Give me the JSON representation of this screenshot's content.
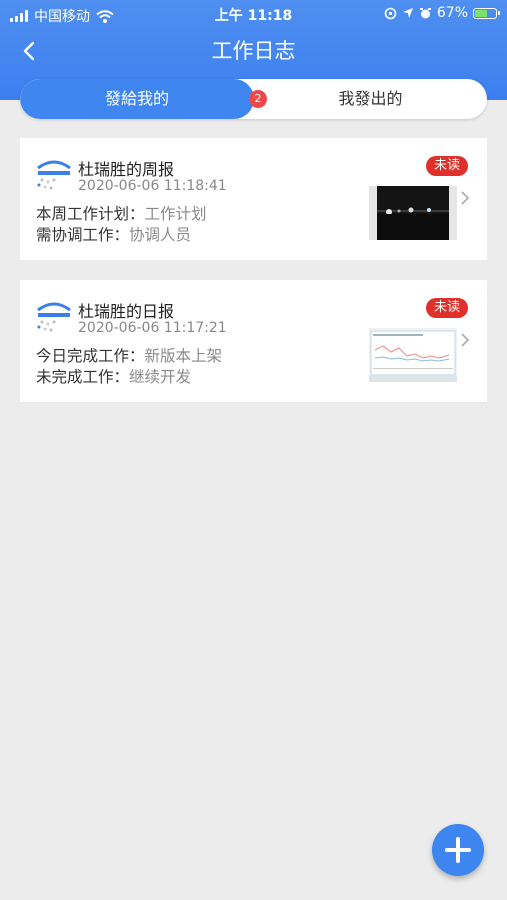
{
  "status_bar": {
    "carrier": "中国移动",
    "time": "上午 11:18",
    "battery": "67%",
    "battery_level": 0.67
  },
  "nav": {
    "back_icon": "chevron-left-icon",
    "title": "工作日志"
  },
  "tabs": {
    "received": {
      "label": "發給我的",
      "badge": "2"
    },
    "sent": {
      "label": "我發出的"
    }
  },
  "logs": [
    {
      "name": "杜瑞胜的周报",
      "time": "2020-06-06 11:18:41",
      "status": "未读",
      "line1_label": "本周工作计划：",
      "line1_value": "工作计划",
      "line2_label": "需协调工作：",
      "line2_value": "协调人员"
    },
    {
      "name": "杜瑞胜的日报",
      "time": "2020-06-06 11:17:21",
      "status": "未读",
      "line1_label": "今日完成工作：",
      "line1_value": "新版本上架",
      "line2_label": "未完成工作：",
      "line2_value": "继续开发"
    }
  ],
  "fab": {
    "icon": "plus-icon"
  },
  "colors": {
    "primary": "#3f86f0",
    "unread": "#e0302a",
    "badge": "#f04848",
    "background": "#ececec"
  }
}
